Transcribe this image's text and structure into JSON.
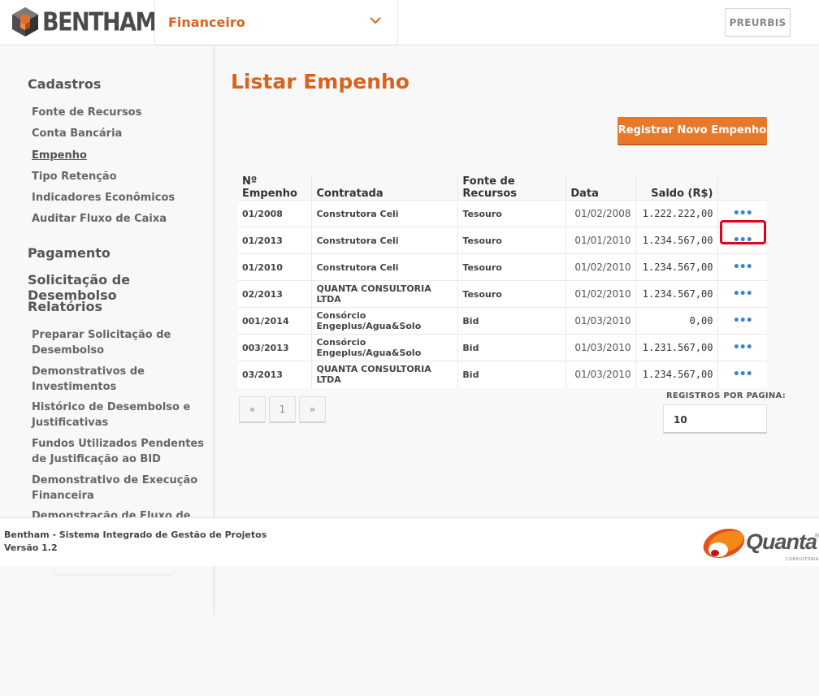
{
  "header": {
    "logo_text": "BENTHAM",
    "module": "Financeiro",
    "user_button": "PREURBIS"
  },
  "sidebar": {
    "sections": [
      {
        "title": "Cadastros",
        "items": [
          "Fonte de Recursos",
          "Conta Bancária",
          "Empenho",
          "Tipo Retenção",
          "Indicadores Econômicos",
          "Auditar Fluxo de Caixa"
        ]
      },
      {
        "title": "Pagamento"
      },
      {
        "title": "Solicitação de Desembolso"
      },
      {
        "title": "Relatórios",
        "items": [
          "Preparar Solicitação de Desembolso",
          "Demonstrativos de Investimentos",
          "Histórico de Desembolso e Justificativas",
          "Fundos Utilizados Pendentes de Justificação ao BID",
          "Demonstrativo de Execução Financeira",
          "Demonstração de Fluxo de Caixa"
        ]
      }
    ],
    "active_item": "Empenho"
  },
  "main": {
    "title": "Listar Empenho",
    "new_button": "Registrar Novo Empenho",
    "table": {
      "columns": [
        "Nº Empenho",
        "Contratada",
        "Fonte de Recursos",
        "Data",
        "Saldo (R$)",
        ""
      ],
      "rows": [
        {
          "numero": "01/2008",
          "contratada": "Construtora Celi",
          "fonte": "Tesouro",
          "data": "01/02/2008",
          "saldo": "1.222.222,00",
          "acao": "•••"
        },
        {
          "numero": "01/2013",
          "contratada": "Construtora Celi",
          "fonte": "Tesouro",
          "data": "01/01/2010",
          "saldo": "1.234.567,00",
          "acao": "•••"
        },
        {
          "numero": "01/2010",
          "contratada": "Construtora Celi",
          "fonte": "Tesouro",
          "data": "01/02/2010",
          "saldo": "1.234.567,00",
          "acao": "•••"
        },
        {
          "numero": "02/2013",
          "contratada": "QUANTA CONSULTORIA LTDA",
          "fonte": "Tesouro",
          "data": "01/02/2010",
          "saldo": "1.234.567,00",
          "acao": "•••"
        },
        {
          "numero": "001/2014",
          "contratada": "Consórcio Engeplus/Agua&Solo",
          "fonte": "Bid",
          "data": "01/03/2010",
          "saldo": "0,00",
          "acao": "•••"
        },
        {
          "numero": "003/2013",
          "contratada": "Consórcio Engeplus/Agua&Solo",
          "fonte": "Bid",
          "data": "01/03/2010",
          "saldo": "1.231.567,00",
          "acao": "•••"
        },
        {
          "numero": "03/2013",
          "contratada": "QUANTA CONSULTORIA LTDA",
          "fonte": "Bid",
          "data": "01/03/2010",
          "saldo": "1.234.567,00",
          "acao": "•••"
        }
      ]
    },
    "pagination": {
      "prev": "«",
      "page": "1",
      "next": "»"
    },
    "per_page": {
      "label": "REGISTROS POR PAGINA:",
      "value": "10"
    }
  },
  "footer": {
    "line1": "Bentham - Sistema Integrado de Gestão de Projetos",
    "line2": "Versão 1.2",
    "brand": "Quanta",
    "brand_sub": "CONSULTORIA",
    "brand_reg": "®"
  },
  "colors": {
    "accent": "#d9631c",
    "button": "#e8792a",
    "link_blue": "#3b7fd6",
    "highlight": "#e0001b"
  }
}
